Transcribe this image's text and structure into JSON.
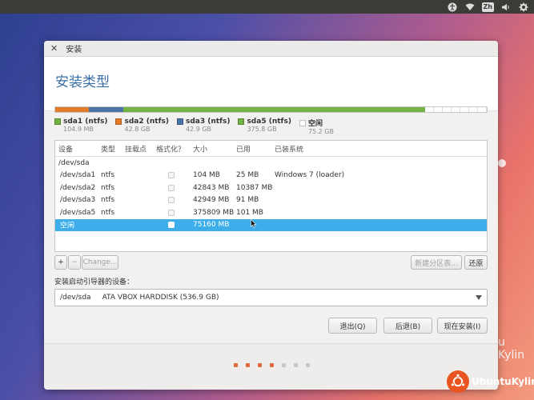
{
  "topbar": {
    "input_method": "Zh"
  },
  "background": {
    "partial_text": "u Kylin"
  },
  "window": {
    "title": "安装",
    "heading": "安装类型"
  },
  "partition_bar": [
    {
      "label": "sda1 (ntfs)",
      "size": "104.9 MB",
      "color": "#e07b29",
      "fraction": 0.078
    },
    {
      "label": "sda2 (ntfs)",
      "size": "42.8 GB",
      "color": "#4d74a8",
      "fraction": 0.08
    },
    {
      "label": "sda3 (ntfs)",
      "size": "42.9 GB",
      "color": "#73b243",
      "fraction": 0.7
    },
    {
      "label": "sda5 (ntfs)",
      "size": "375.8 GB",
      "color": "#73b243",
      "fraction": 0.0
    },
    {
      "label": "空闲",
      "size": "75.2 GB",
      "color": "#ffffff",
      "fraction": 0.142
    }
  ],
  "legend": [
    {
      "label": "sda1 (ntfs)",
      "size": "104.9 MB",
      "color": "#73b243"
    },
    {
      "label": "sda2 (ntfs)",
      "size": "42.8 GB",
      "color": "#e07b29"
    },
    {
      "label": "sda3 (ntfs)",
      "size": "42.9 GB",
      "color": "#4d74a8"
    },
    {
      "label": "sda5 (ntfs)",
      "size": "375.8 GB",
      "color": "#73b243"
    },
    {
      "label": "空闲",
      "size": "75.2 GB",
      "color": "#ffffff"
    }
  ],
  "table": {
    "headers": [
      "设备",
      "类型",
      "挂载点",
      "格式化？",
      "大小",
      "已用",
      "已装系统"
    ],
    "rows": [
      {
        "device": "/dev/sda",
        "type": "",
        "mount": "",
        "format": false,
        "size": "",
        "used": "",
        "system": "",
        "group": true
      },
      {
        "device": "/dev/sda1",
        "type": "ntfs",
        "mount": "",
        "format": true,
        "size": "104 MB",
        "used": "25 MB",
        "system": "Windows 7 (loader)"
      },
      {
        "device": "/dev/sda2",
        "type": "ntfs",
        "mount": "",
        "format": true,
        "size": "42843 MB",
        "used": "10387 MB",
        "system": ""
      },
      {
        "device": "/dev/sda3",
        "type": "ntfs",
        "mount": "",
        "format": true,
        "size": "42949 MB",
        "used": "91 MB",
        "system": ""
      },
      {
        "device": "/dev/sda5",
        "type": "ntfs",
        "mount": "",
        "format": true,
        "size": "375809 MB",
        "used": "101 MB",
        "system": ""
      },
      {
        "device": "空闲",
        "type": "",
        "mount": "",
        "format": true,
        "size": "75160 MB",
        "used": "",
        "system": "",
        "selected": true
      }
    ]
  },
  "toolbar": {
    "add": "+",
    "remove": "−",
    "change": "Change...",
    "new_table": "新建分区表...",
    "revert": "还原"
  },
  "boot": {
    "label": "安装启动引导器的设备：",
    "device": "/dev/sda",
    "description": "ATA VBOX HARDDISK (536.9 GB)"
  },
  "buttons": {
    "quit": "退出(Q)",
    "back": "后退(B)",
    "install": "现在安装(I)"
  },
  "progress": {
    "total": 7,
    "done": 4,
    "active_color": "#dd6b3d",
    "inactive_color": "#c8c8c8"
  },
  "brand": {
    "name": "UbuntuKylin"
  }
}
